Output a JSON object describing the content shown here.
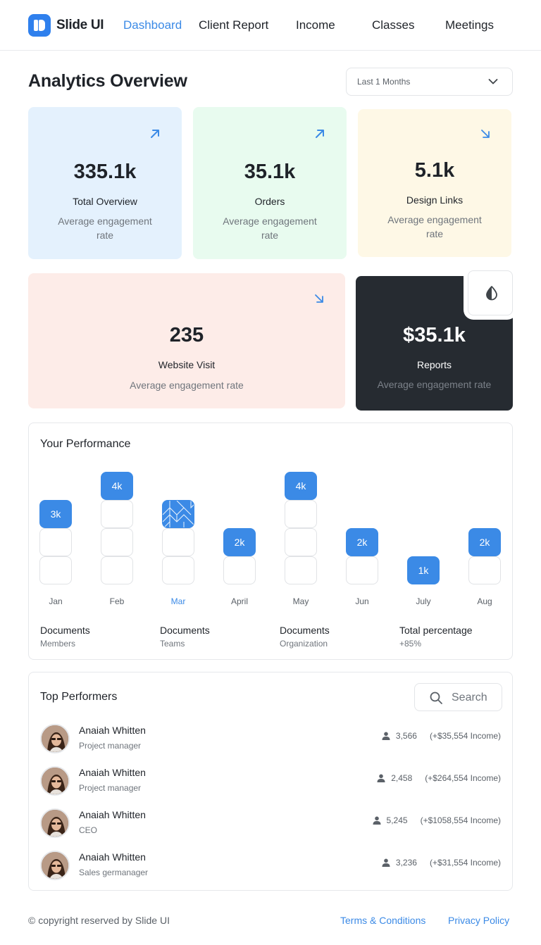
{
  "brand": {
    "name": "Slide UI"
  },
  "nav": [
    "Dashboard",
    "Client Report",
    "Income",
    "Classes",
    "Meetings"
  ],
  "page": {
    "title": "Analytics Overview",
    "period": "Last 1 Months"
  },
  "stats": [
    {
      "value": "335.1k",
      "label": "Total Overview",
      "sub": "Average engagement rate",
      "trend": "up"
    },
    {
      "value": "35.1k",
      "label": "Orders",
      "sub": "Average engagement rate",
      "trend": "up"
    },
    {
      "value": "5.1k",
      "label": "Design Links",
      "sub": "Average engagement rate",
      "trend": "down"
    },
    {
      "value": "235",
      "label": "Website Visit",
      "sub": "Average engagement rate",
      "trend": "down"
    },
    {
      "value": "$35.1k",
      "label": "Reports",
      "sub": "Average engagement rate"
    }
  ],
  "performance": {
    "title": "Your Performance",
    "chart_data": {
      "type": "bar",
      "categories": [
        "Jan",
        "Feb",
        "Mar",
        "April",
        "May",
        "Jun",
        "July",
        "Aug"
      ],
      "values": [
        3,
        4,
        3,
        2,
        4,
        2,
        1,
        2
      ],
      "labels": [
        "3k",
        "4k",
        "",
        "2k",
        "4k",
        "2k",
        "1k",
        "2k"
      ],
      "highlighted": "Mar"
    },
    "summary": [
      {
        "title": "Documents",
        "sub": "Members"
      },
      {
        "title": "Documents",
        "sub": "Teams"
      },
      {
        "title": "Documents",
        "sub": "Organization"
      },
      {
        "title": "Total percentage",
        "sub": "+85%"
      }
    ]
  },
  "performers": {
    "title": "Top Performers",
    "search_label": "Search",
    "items": [
      {
        "name": "Anaiah Whitten",
        "role": "Project manager",
        "count": "3,566",
        "income": "(+$35,554 Income)"
      },
      {
        "name": "Anaiah Whitten",
        "role": "Project manager",
        "count": "2,458",
        "income": "(+$264,554 Income)"
      },
      {
        "name": "Anaiah Whitten",
        "role": "CEO",
        "count": "5,245",
        "income": "(+$1058,554 Income)"
      },
      {
        "name": "Anaiah Whitten",
        "role": "Sales germanager",
        "count": "3,236",
        "income": "(+$31,554 Income)"
      }
    ]
  },
  "footer": {
    "copyright": "© copyright reserved by Slide UI",
    "terms": "Terms & Conditions",
    "privacy": "Privacy Policy"
  }
}
